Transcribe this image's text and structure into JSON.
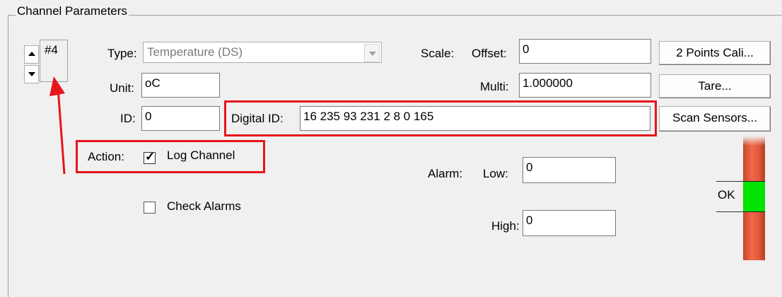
{
  "group": {
    "title": "Channel Parameters"
  },
  "channel": {
    "number": "#4"
  },
  "type": {
    "label": "Type:",
    "value": "Temperature (DS)"
  },
  "unit": {
    "label": "Unit:",
    "value": "oC"
  },
  "id": {
    "label": "ID:",
    "value": "0"
  },
  "digital_id": {
    "label": "Digital ID:",
    "value": "16 235 93 231 2 8 0 165"
  },
  "scale": {
    "label": "Scale:",
    "offset_label": "Offset:",
    "offset_value": "0",
    "multi_label": "Multi:",
    "multi_value": "1.000000"
  },
  "buttons": {
    "calibrate": "2 Points Cali...",
    "tare": "Tare...",
    "scan": "Scan Sensors..."
  },
  "action": {
    "label": "Action:",
    "log_channel": {
      "label": "Log Channel",
      "checked": true
    },
    "check_alarms": {
      "label": "Check Alarms",
      "checked": false
    }
  },
  "alarm": {
    "label": "Alarm:",
    "low_label": "Low:",
    "low_value": "0",
    "high_label": "High:",
    "high_value": "0"
  },
  "status": {
    "label": "OK",
    "ok_color": "#00e400",
    "alarm_color": "#f06848"
  },
  "annotations": {
    "highlight_color": "#e8141b"
  },
  "icons": [
    "spin-up-icon",
    "spin-down-icon",
    "dropdown-arrow-icon",
    "checkmark-icon",
    "annotation-arrow-icon"
  ]
}
